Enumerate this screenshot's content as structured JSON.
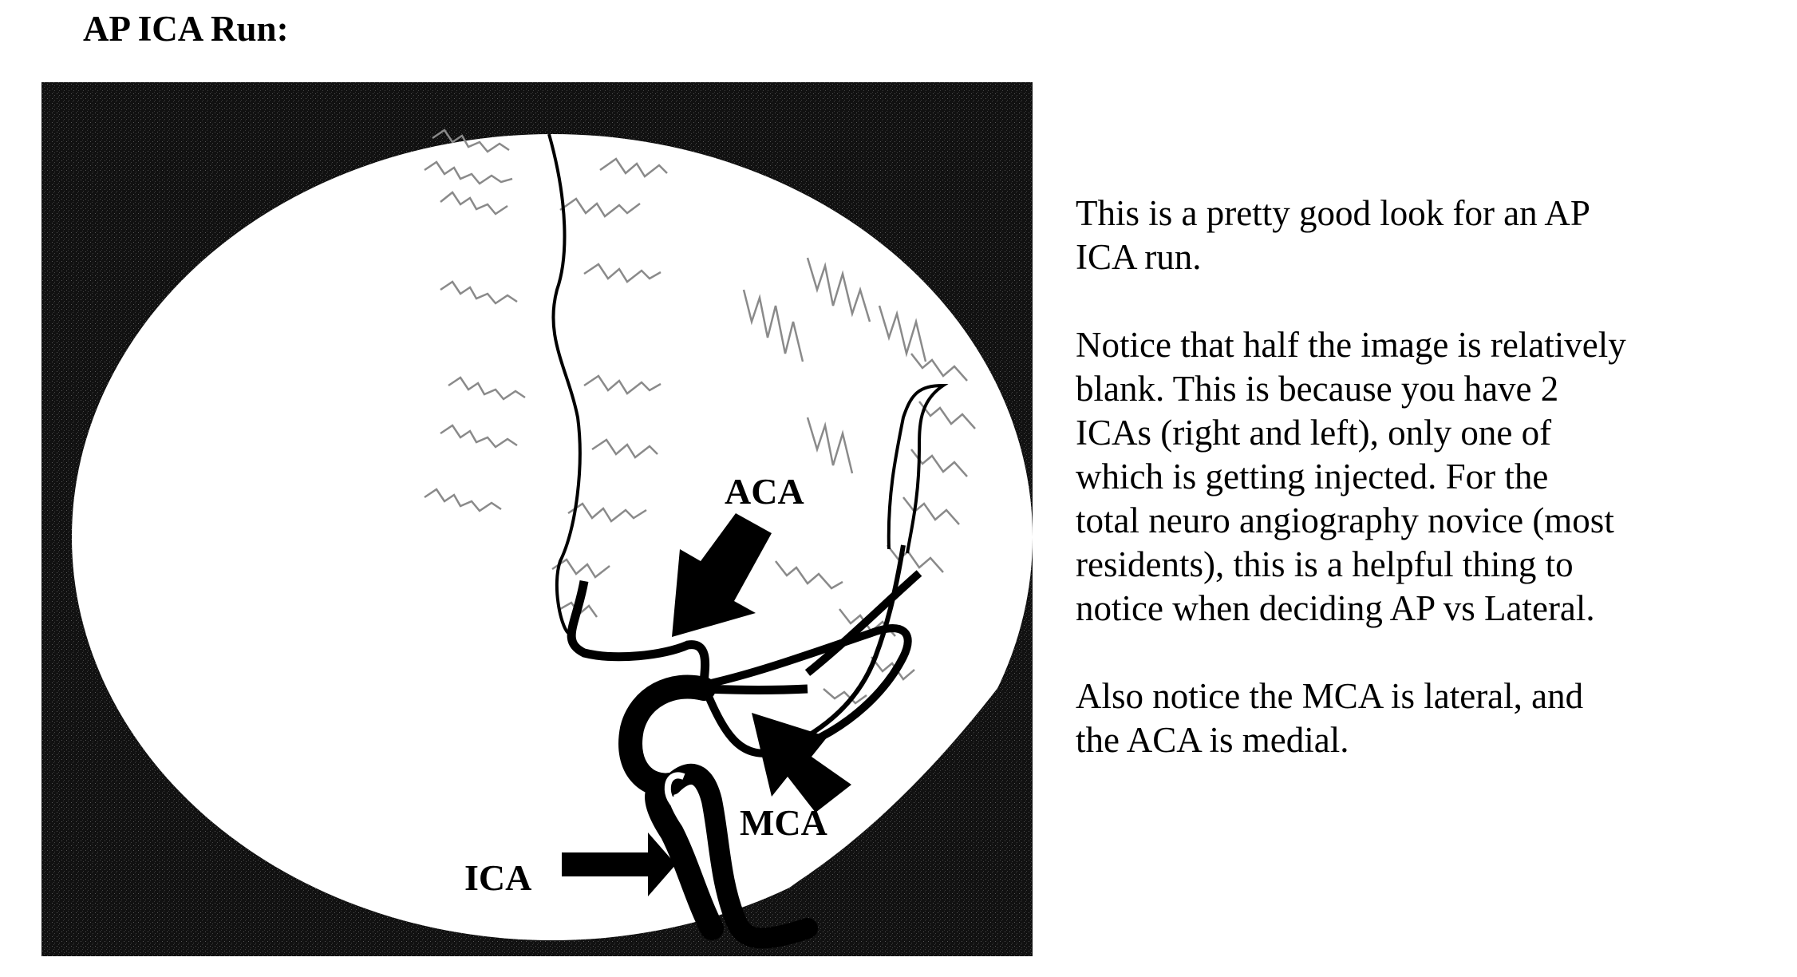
{
  "page": {
    "title": "AP ICA Run:"
  },
  "figure": {
    "labels": {
      "aca": "ACA",
      "mca": "MCA",
      "ica": "ICA"
    },
    "colors": {
      "background": "#111111",
      "field": "#ffffff",
      "vessel": "#000000",
      "fine_vessels": "#8a8a8a"
    }
  },
  "notes": {
    "paragraph_1": "This is a pretty good look for an AP\nICA run.",
    "paragraph_2": "Notice that half the image is relatively\nblank.  This is because you have 2\nICAs (right and left), only one of\nwhich is getting injected.  For the\ntotal neuro angiography novice (most\nresidents), this is a helpful thing to\nnotice when deciding AP vs Lateral.",
    "paragraph_3": "Also notice the MCA is lateral, and\nthe ACA is medial."
  }
}
